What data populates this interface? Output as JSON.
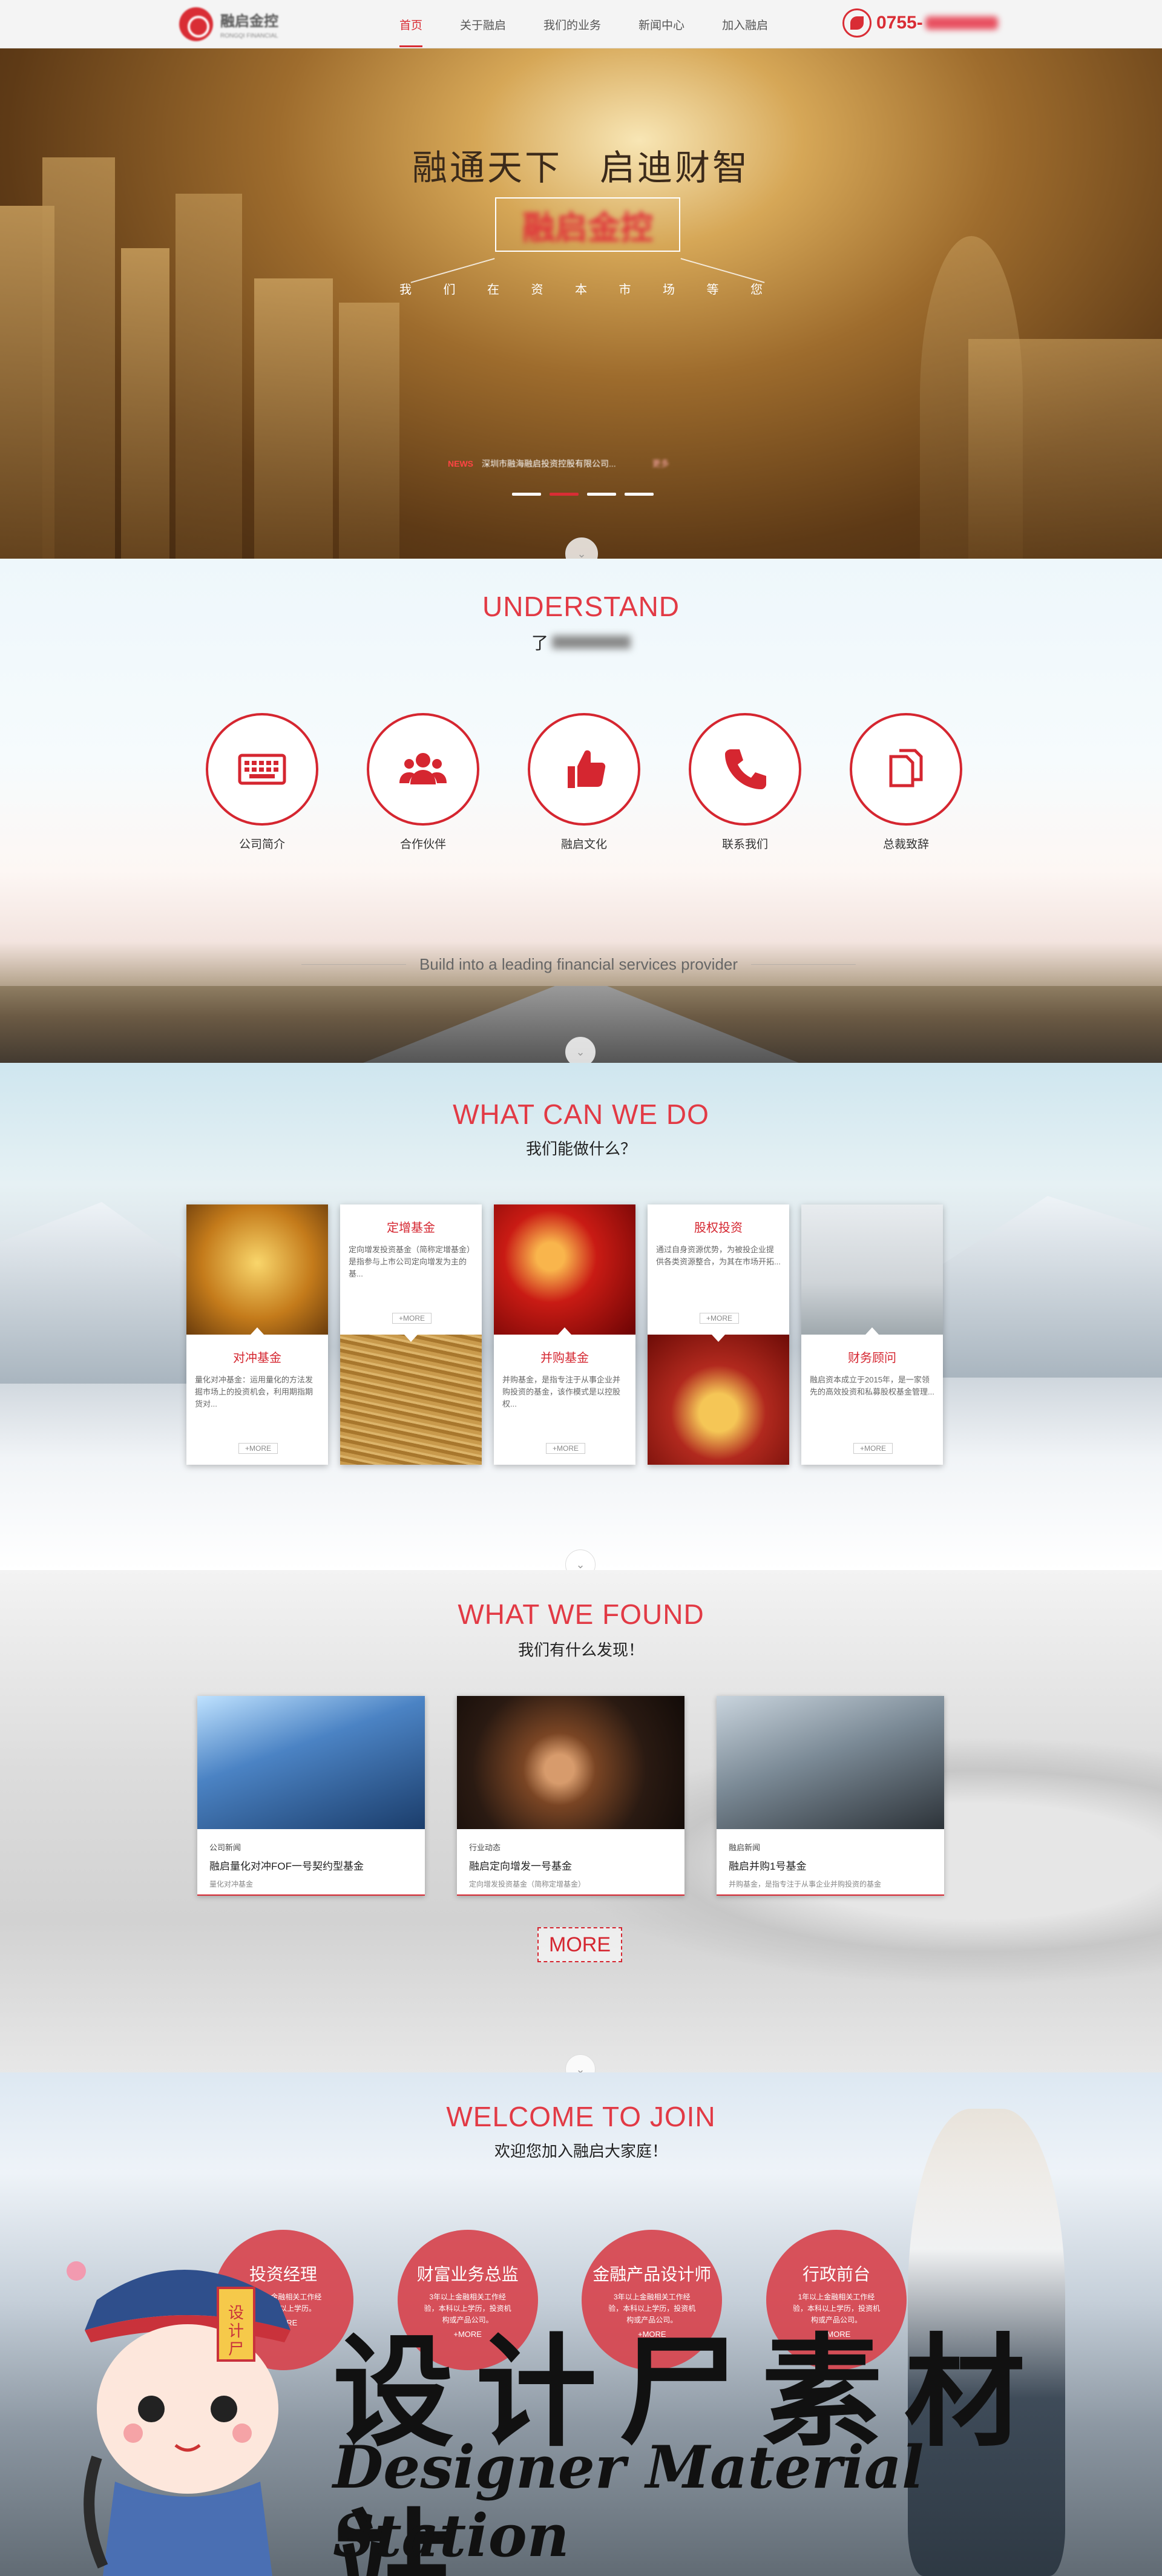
{
  "nav": {
    "logo_text": "融启金控",
    "logo_sub": "RONGQI FINANCIAL",
    "items": [
      "首页",
      "关于融启",
      "我们的业务",
      "新闻中心",
      "加入融启"
    ],
    "phone": "0755-",
    "phone_icon": "phone-icon"
  },
  "hero": {
    "title": "融通天下　启迪财智",
    "brand": "融启金控",
    "subtitle_chars": [
      "我",
      "们",
      "在",
      "资",
      "本",
      "市",
      "场",
      "等",
      "您"
    ],
    "news_label": "NEWS",
    "news_text": "深圳市融海融启投资控股有限公司...",
    "news_more": "更多",
    "slides": 4,
    "active_slide": 1,
    "arrow": "⌄"
  },
  "understand": {
    "title_en": "UNDERSTAND",
    "title_cn": "了",
    "items": [
      {
        "label": "公司简介",
        "icon": "keyboard-icon"
      },
      {
        "label": "合作伙伴",
        "icon": "people-icon"
      },
      {
        "label": "融启文化",
        "icon": "thumbs-up-icon"
      },
      {
        "label": "联系我们",
        "icon": "phone-icon"
      },
      {
        "label": "总裁致辞",
        "icon": "document-icon"
      }
    ],
    "tagline": "Build into a leading financial services provider"
  },
  "cando": {
    "title_en": "WHAT CAN WE DO",
    "title_cn": "我们能做什么？",
    "more": "+MORE",
    "cards": [
      {
        "title": "对冲基金",
        "desc": "量化对冲基金：运用量化的方法发掘市场上的投资机会，利用期指期货对...",
        "text_pos": "bottom",
        "image": "yen-image",
        "image_class": "img-yen"
      },
      {
        "title": "定增基金",
        "desc": "定向增发投资基金（简称定增基金）是指参与上市公司定向增发为主的基...",
        "text_pos": "top",
        "image": "coins-image",
        "image_class": "img-coins"
      },
      {
        "title": "并购基金",
        "desc": "并购基金，是指专注于从事企业并购投资的基金，该作模式是以控股权...",
        "text_pos": "bottom",
        "image": "gold-nuggets-image",
        "image_class": "img-red"
      },
      {
        "title": "股权投资",
        "desc": "通过自身资源优势，为被投企业提供各类资源整合，为其在市场开拓...",
        "text_pos": "top",
        "image": "gold-bars-image",
        "image_class": "img-gold"
      },
      {
        "title": "财务顾问",
        "desc": "融启资本成立于2015年，是一家领先的高效投资和私募股权基金管理...",
        "text_pos": "bottom",
        "image": "meeting-image",
        "image_class": "img-people"
      }
    ]
  },
  "found": {
    "title_en": "WHAT WE FOUND",
    "title_cn": "我们有什么发现！",
    "cards": [
      {
        "category": "公司新闻",
        "title": "融启量化对冲FOF一号契约型基金",
        "desc": "量化对冲基金"
      },
      {
        "category": "行业动态",
        "title": "融启定向增发一号基金",
        "desc": "定向增发投资基金（简称定增基金）"
      },
      {
        "category": "融启新闻",
        "title": "融启并购1号基金",
        "desc": "并购基金，是指专注于从事企业并购投资的基金"
      }
    ],
    "more_button": "MORE"
  },
  "join": {
    "title_en": "WELCOME TO JOIN",
    "title_cn": "欢迎您加入融启大家庭！",
    "positions": [
      {
        "title": "投资经理",
        "desc": "3年以上金融相关工作经验，本科以上学历。",
        "more": "+MORE"
      },
      {
        "title": "财富业务总监",
        "desc": "3年以上金融相关工作经验，本科以上学历，投资机构或产品公司。",
        "more": "+MORE"
      },
      {
        "title": "金融产品设计师",
        "desc": "3年以上金融相关工作经验，本科以上学历，投资机构或产品公司。",
        "more": "+MORE"
      },
      {
        "title": "行政前台",
        "desc": "1年以上金融相关工作经验，本科以上学历，投资机构或产品公司。",
        "more": "+MORE"
      }
    ]
  },
  "watermark": {
    "zh": "设计尸素材站",
    "en": "Designer Material Station",
    "badge": "设计尸"
  },
  "colors": {
    "accent": "#d52630",
    "nav_bg": "#f4f4f4"
  }
}
